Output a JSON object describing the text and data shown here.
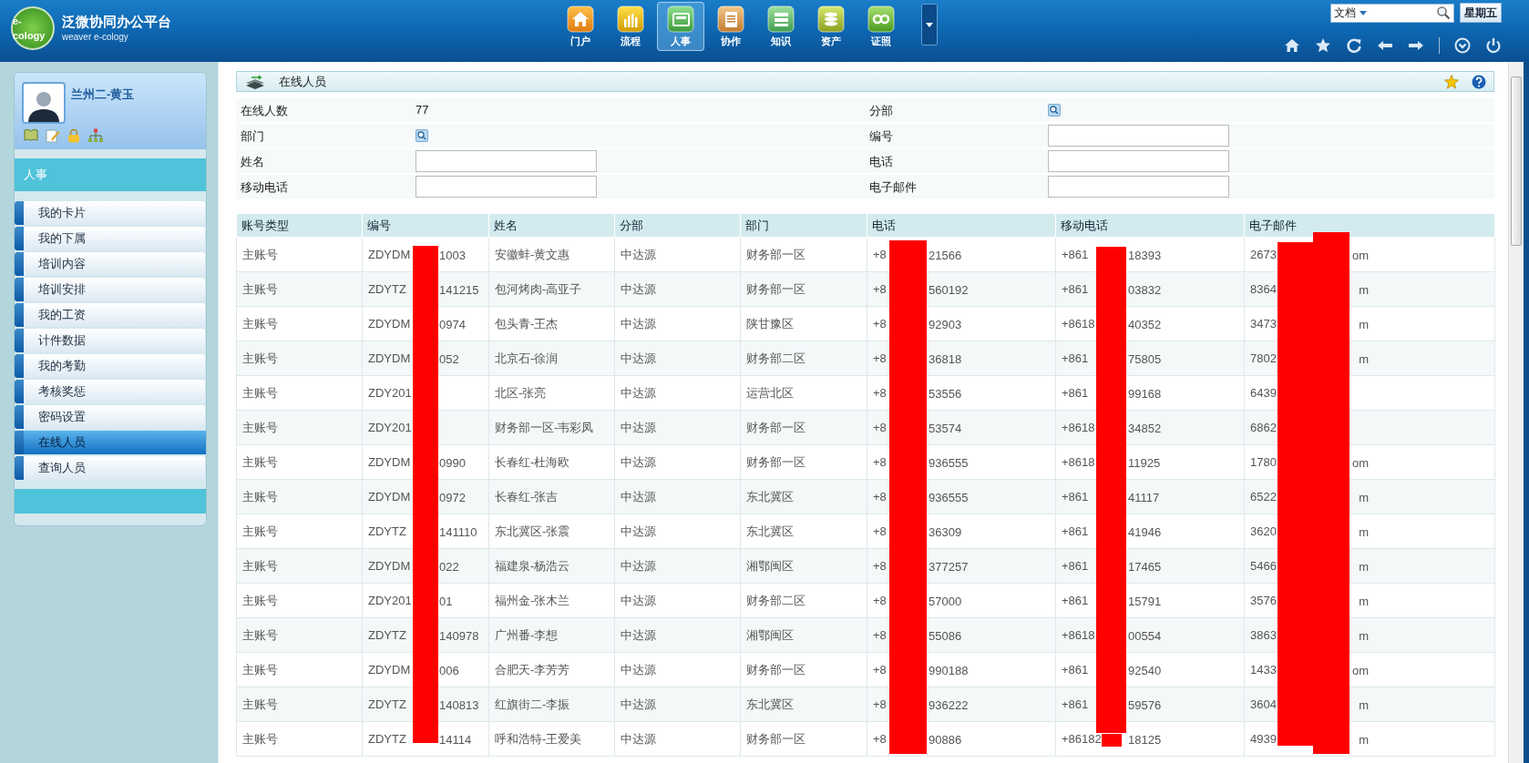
{
  "header": {
    "logo": "e-cology",
    "title": "泛微协同办公平台",
    "subtitle": "weaver e-cology",
    "nav": [
      {
        "label": "门户",
        "kind": "home",
        "selected": false
      },
      {
        "label": "流程",
        "kind": "chart",
        "selected": false
      },
      {
        "label": "人事",
        "kind": "card",
        "selected": true
      },
      {
        "label": "协作",
        "kind": "clipboard",
        "selected": false
      },
      {
        "label": "知识",
        "kind": "list",
        "selected": false
      },
      {
        "label": "资产",
        "kind": "coins",
        "selected": false
      },
      {
        "label": "证照",
        "kind": "link",
        "selected": false
      }
    ],
    "search": {
      "scope": "文档"
    },
    "day_button": "星期五"
  },
  "sidebar": {
    "user": "兰州二-黄玉",
    "section": "人事",
    "items": [
      {
        "label": "我的卡片",
        "selected": false
      },
      {
        "label": "我的下属",
        "selected": false
      },
      {
        "label": "培训内容",
        "selected": false
      },
      {
        "label": "培训安排",
        "selected": false
      },
      {
        "label": "我的工资",
        "selected": false
      },
      {
        "label": "计件数据",
        "selected": false
      },
      {
        "label": "我的考勤",
        "selected": false
      },
      {
        "label": "考核奖惩",
        "selected": false
      },
      {
        "label": "密码设置",
        "selected": false
      },
      {
        "label": "在线人员",
        "selected": true
      },
      {
        "label": "查询人员",
        "selected": false
      }
    ]
  },
  "panel": {
    "title": "在线人员",
    "form": [
      [
        {
          "label": "在线人数",
          "kind": "text",
          "value": "77"
        },
        {
          "label": "分部",
          "kind": "browse"
        }
      ],
      [
        {
          "label": "部门",
          "kind": "browse"
        },
        {
          "label": "编号",
          "kind": "input"
        }
      ],
      [
        {
          "label": "姓名",
          "kind": "input"
        },
        {
          "label": "电话",
          "kind": "input"
        }
      ],
      [
        {
          "label": "移动电话",
          "kind": "input"
        },
        {
          "label": "电子邮件",
          "kind": "input"
        }
      ]
    ],
    "table": {
      "columns": [
        "账号类型",
        "编号",
        "姓名",
        "分部",
        "部门",
        "电话",
        "移动电话",
        "电子邮件"
      ],
      "rows": [
        [
          "主账号",
          {
            "before": "ZDYDM",
            "after": "1003"
          },
          "安徽蚌-黄文惠",
          "中达源",
          "财务部一区",
          {
            "before": "+8",
            "after": "21566"
          },
          {
            "before": "+861",
            "after": "18393"
          },
          {
            "before": "2673",
            "after": "om"
          }
        ],
        [
          "主账号",
          {
            "before": "ZDYTZ",
            "after": "141215"
          },
          "包河烤肉-高亚子",
          "中达源",
          "财务部一区",
          {
            "before": "+8",
            "after": "560192"
          },
          {
            "before": "+861",
            "after": "03832"
          },
          {
            "before": "8364",
            "after": "m"
          }
        ],
        [
          "主账号",
          {
            "before": "ZDYDM",
            "after": "0974"
          },
          "包头青-王杰",
          "中达源",
          "陕甘豫区",
          {
            "before": "+8",
            "after": "92903"
          },
          {
            "before": "+8618",
            "after": "40352"
          },
          {
            "before": "3473",
            "after": "m"
          }
        ],
        [
          "主账号",
          {
            "before": "ZDYDM",
            "after": "052"
          },
          "北京石-徐润",
          "中达源",
          "财务部二区",
          {
            "before": "+8",
            "after": "36818"
          },
          {
            "before": "+861",
            "after": "75805"
          },
          {
            "before": "7802",
            "after": "m"
          }
        ],
        [
          "主账号",
          {
            "before": "ZDY201"
          },
          "北区-张亮",
          "中达源",
          "运营北区",
          {
            "before": "+8",
            "after": "53556"
          },
          {
            "before": "+861",
            "after": "99168"
          },
          {
            "before": "6439"
          }
        ],
        [
          "主账号",
          {
            "before": "ZDY201"
          },
          "财务部一区-韦彩凤",
          "中达源",
          "财务部一区",
          {
            "before": "+8",
            "after": "53574"
          },
          {
            "before": "+8618",
            "after": "34852"
          },
          {
            "before": "6862"
          }
        ],
        [
          "主账号",
          {
            "before": "ZDYDM",
            "after": "0990"
          },
          "长春红-杜海欧",
          "中达源",
          "财务部一区",
          {
            "before": "+8",
            "after": "936555"
          },
          {
            "before": "+8618",
            "after": "11925"
          },
          {
            "before": "1780",
            "after": "om"
          }
        ],
        [
          "主账号",
          {
            "before": "ZDYDM",
            "after": "0972"
          },
          "长春红-张吉",
          "中达源",
          "东北冀区",
          {
            "before": "+8",
            "after": "936555"
          },
          {
            "before": "+861",
            "after": "41117"
          },
          {
            "before": "6522",
            "after": "m"
          }
        ],
        [
          "主账号",
          {
            "before": "ZDYTZ",
            "after": "141110"
          },
          "东北冀区-张震",
          "中达源",
          "东北冀区",
          {
            "before": "+8",
            "after": "36309"
          },
          {
            "before": "+861",
            "after": "41946"
          },
          {
            "before": "3620",
            "after": "m"
          }
        ],
        [
          "主账号",
          {
            "before": "ZDYDM",
            "after": "022"
          },
          "福建泉-杨浩云",
          "中达源",
          "湘鄂闽区",
          {
            "before": "+8",
            "after": "377257"
          },
          {
            "before": "+861",
            "after": "17465"
          },
          {
            "before": "5466",
            "after": "m"
          }
        ],
        [
          "主账号",
          {
            "before": "ZDY201",
            "after": "01"
          },
          "福州金-张木兰",
          "中达源",
          "财务部二区",
          {
            "before": "+8",
            "after": "57000"
          },
          {
            "before": "+861",
            "after": "15791"
          },
          {
            "before": "3576",
            "after": "m"
          }
        ],
        [
          "主账号",
          {
            "before": "ZDYTZ",
            "after": "140978"
          },
          "广州番-李想",
          "中达源",
          "湘鄂闽区",
          {
            "before": "+8",
            "after": "55086"
          },
          {
            "before": "+8618",
            "after": "00554"
          },
          {
            "before": "3863",
            "after": "m"
          }
        ],
        [
          "主账号",
          {
            "before": "ZDYDM",
            "after": "006"
          },
          "合肥天-李芳芳",
          "中达源",
          "财务部一区",
          {
            "before": "+8",
            "after": "990188"
          },
          {
            "before": "+861",
            "after": "92540"
          },
          {
            "before": "1433",
            "after": "om"
          }
        ],
        [
          "主账号",
          {
            "before": "ZDYTZ",
            "after": "140813"
          },
          "红旗街二-李振",
          "中达源",
          "东北冀区",
          {
            "before": "+8",
            "after": "936222"
          },
          {
            "before": "+861",
            "after": "59576"
          },
          {
            "before": "3604",
            "after": "m"
          }
        ],
        [
          "主账号",
          {
            "before": "ZDYTZ",
            "after": "14114"
          },
          "呼和浩特-王爱美",
          "中达源",
          "财务部一区",
          {
            "before": "+8",
            "after": "90886"
          },
          {
            "before": "+86182",
            "after": "18125"
          },
          {
            "before": "4939",
            "after": "m"
          }
        ]
      ]
    }
  }
}
